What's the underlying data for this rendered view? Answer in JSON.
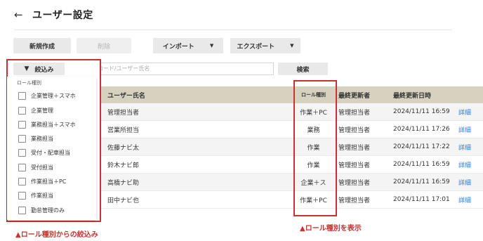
{
  "header": {
    "back_icon": "←",
    "title": "ユーザー設定"
  },
  "toolbar": {
    "new_label": "新規作成",
    "delete_label": "削除",
    "import_label": "インポート",
    "export_label": "エクスポート",
    "caret": "▼"
  },
  "search": {
    "filter_label": "絞込み",
    "funnel_icon": "▼",
    "placeholder": "ユーザーコード/ユーザー氏名",
    "search_label": "検索"
  },
  "filter_panel": {
    "heading": "ロール種別",
    "options": [
      "企業管理＋スマホ",
      "企業管理",
      "業務担当＋スマホ",
      "業務担当",
      "受付・配車担当",
      "受付担当",
      "作業担当＋PC",
      "作業担当",
      "勤怠管理のみ"
    ]
  },
  "table": {
    "headers": {
      "name": "ユーザー氏名",
      "role": "ロール種別",
      "updater": "最終更新者",
      "date": "最終更新日時"
    },
    "rows": [
      {
        "name": "管理担当者",
        "role": "作業＋PC",
        "updater": "管理担当者",
        "date": "2024/11/11 16:59",
        "detail": "詳細"
      },
      {
        "name": "営業所担当",
        "role": "業務",
        "updater": "管理担当者",
        "date": "2024/11/11 17:26",
        "detail": "詳細"
      },
      {
        "name": "佐藤ナビ太",
        "role": "作業",
        "updater": "管理担当者",
        "date": "2024/11/11 17:22",
        "detail": "詳細"
      },
      {
        "name": "鈴木ナビ郎",
        "role": "作業",
        "updater": "管理担当者",
        "date": "2024/11/11 16:59",
        "detail": "詳細"
      },
      {
        "name": "高橋ナビ助",
        "role": "企業＋ス",
        "updater": "管理担当者",
        "date": "2024/11/11 16:59",
        "detail": "詳細"
      },
      {
        "name": "田中ナビ也",
        "role": "作業＋PC",
        "updater": "管理担当者",
        "date": "2024/11/11 17:01",
        "detail": "詳細"
      }
    ]
  },
  "captions": {
    "filter_caption": "▲ロール種別からの絞込み",
    "role_caption": "▲ロール種別を表示"
  },
  "colors": {
    "highlight": "#c8322f",
    "header_bg": "#d7d1bf",
    "link": "#2f7bd6"
  }
}
